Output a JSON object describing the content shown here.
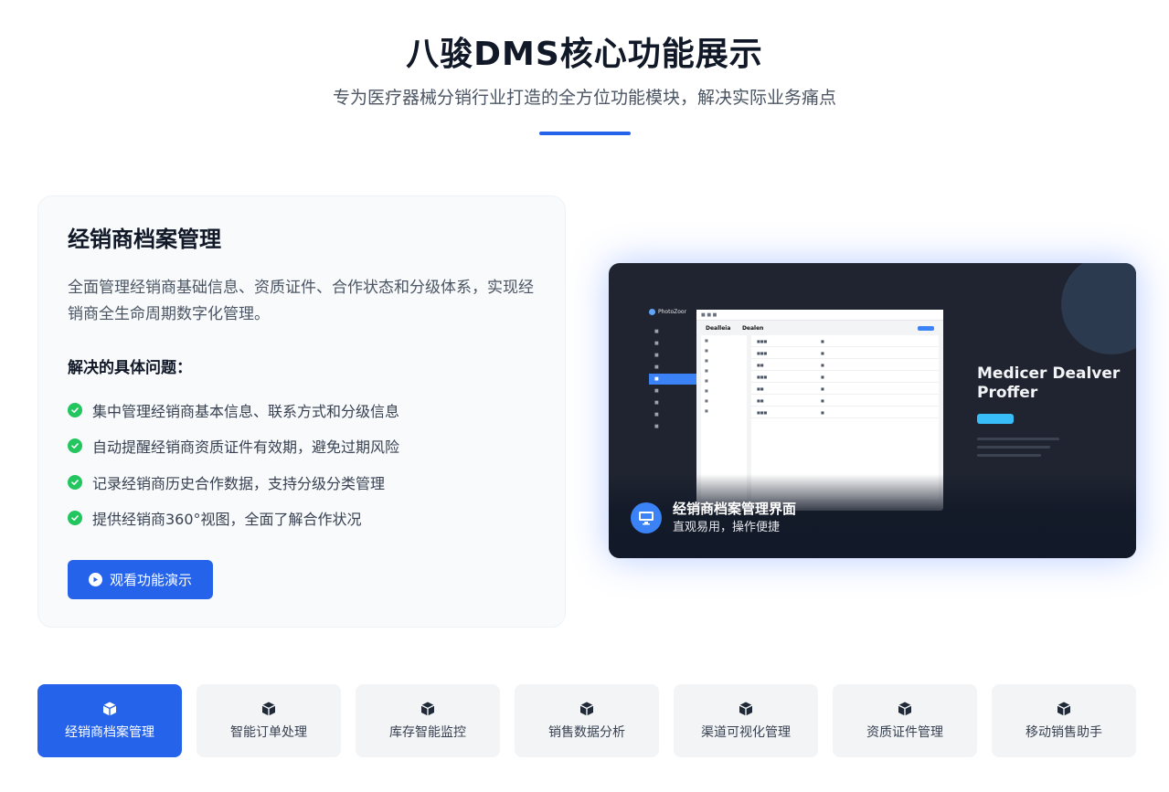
{
  "header": {
    "title": "八骏DMS核心功能展示",
    "subtitle": "专为医疗器械分销行业打造的全方位功能模块，解决实际业务痛点"
  },
  "feature": {
    "title": "经销商档案管理",
    "description": "全面管理经销商基础信息、资质证件、合作状态和分级体系，实现经销商全生命周期数字化管理。",
    "problems_heading": "解决的具体问题：",
    "problems": [
      "集中管理经销商基本信息、联系方式和分级信息",
      "自动提醒经销商资质证件有效期，避免过期风险",
      "记录经销商历史合作数据，支持分级分类管理",
      "提供经销商360°视图，全面了解合作状况"
    ],
    "demo_button": "观看功能演示"
  },
  "preview": {
    "caption_title": "经销商档案管理界面",
    "caption_subtitle": "直观易用，操作便捷",
    "mock_right_title": "Medicer Dealver Proffer",
    "mock_logo": "PhotoZoor",
    "mock_header": "Dealleia",
    "mock_header2": "Dealen"
  },
  "tabs": [
    {
      "label": "经销商档案管理",
      "active": true
    },
    {
      "label": "智能订单处理",
      "active": false
    },
    {
      "label": "库存智能监控",
      "active": false
    },
    {
      "label": "销售数据分析",
      "active": false
    },
    {
      "label": "渠道可视化管理",
      "active": false
    },
    {
      "label": "资质证件管理",
      "active": false
    },
    {
      "label": "移动销售助手",
      "active": false
    }
  ],
  "colors": {
    "accent": "#2563eb",
    "check": "#22c55e"
  }
}
